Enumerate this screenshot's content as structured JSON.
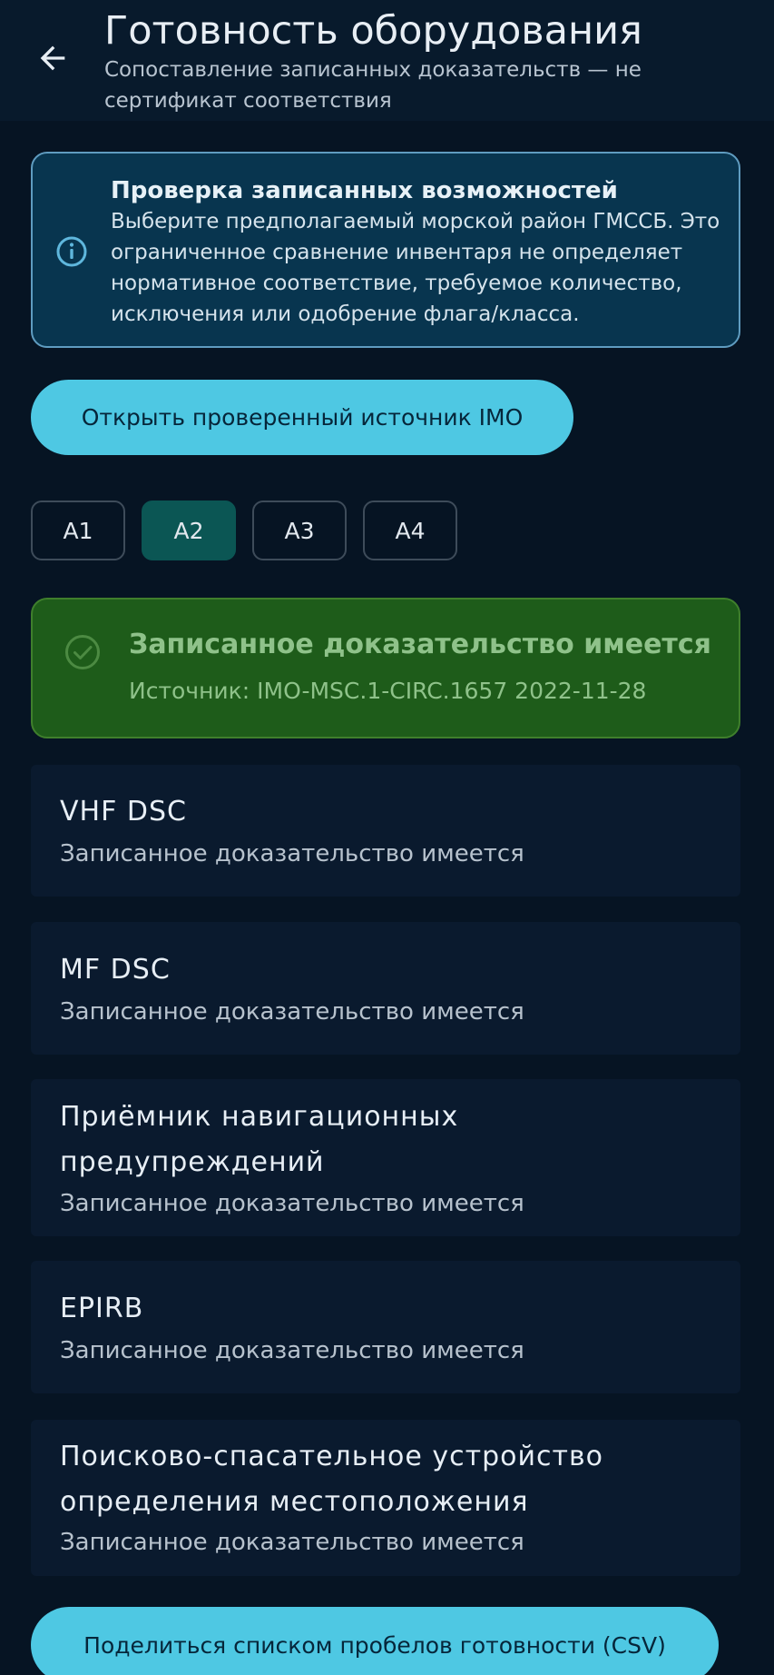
{
  "header": {
    "title": "Готовность оборудования",
    "subtitle": "Сопоставление записанных доказательств — не сертификат соответствия"
  },
  "info": {
    "icon": "info-icon",
    "title": "Проверка записанных возможностей",
    "body": "Выберите предполагаемый морской район ГМССБ. Это ограниченное сравнение инвентаря не определяет нормативное соответствие, требуемое количество, исключения или одобрение флага/класса."
  },
  "source_button": {
    "label": "Открыть проверенный источник IMO"
  },
  "areas": {
    "selected": "A2",
    "items": [
      {
        "label": "A1"
      },
      {
        "label": "A2"
      },
      {
        "label": "A3"
      },
      {
        "label": "A4"
      }
    ]
  },
  "status": {
    "icon": "check-circle-icon",
    "title": "Записанное доказательство имеется",
    "source": "Источник: IMO-MSC.1-CIRC.1657 2022-11-28"
  },
  "equipment": [
    {
      "name": "VHF DSC",
      "status": "Записанное доказательство имеется"
    },
    {
      "name": "MF DSC",
      "status": "Записанное доказательство имеется"
    },
    {
      "name": "Приёмник навигационных предупреждений",
      "status": "Записанное доказательство имеется"
    },
    {
      "name": "EPIRB",
      "status": "Записанное доказательство имеется"
    },
    {
      "name": "Поисково-спасательное устройство определения местоположения",
      "status": "Записанное доказательство имеется"
    }
  ],
  "share_button": {
    "label": "Поделиться списком пробелов готовности (CSV)"
  },
  "colors": {
    "background": "#061423",
    "accent": "#4ec8e3",
    "info_card": "#08354f",
    "status_card": "#1e5c1a",
    "status_text": "#8fc28a",
    "chip_selected": "#0b5654"
  }
}
